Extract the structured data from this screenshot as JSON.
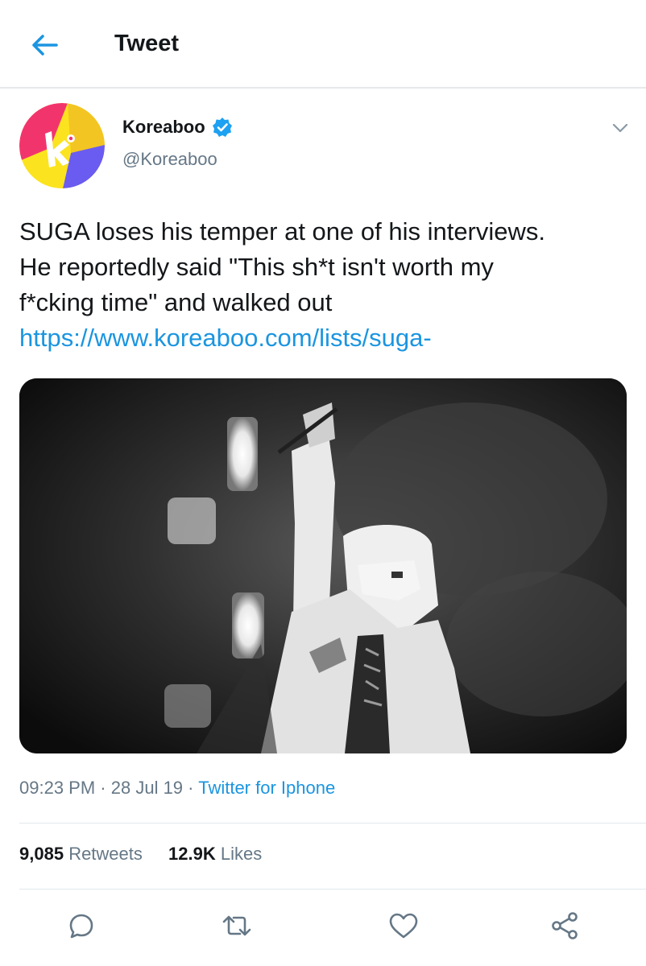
{
  "header": {
    "title": "Tweet"
  },
  "author": {
    "name": "Koreaboo",
    "handle": "@Koreaboo",
    "verified": true
  },
  "tweet": {
    "lines": [
      "SUGA loses his temper at one of his interviews.",
      "He reportedly said \"This sh*t isn't worth my",
      "f*cking time\" and walked out"
    ],
    "link": "https://www.koreaboo.com/lists/suga-"
  },
  "meta": {
    "time": "09:23 PM",
    "date": "28 Jul 19",
    "separator": "·",
    "source": "Twitter for Iphone"
  },
  "stats": {
    "retweets_count": "9,085",
    "retweets_label": "Retweets",
    "likes_count": "12.9K",
    "likes_label": "Likes"
  },
  "colors": {
    "accent": "#1b95e0",
    "text": "#14171a",
    "secondary": "#657786",
    "divider": "#e1e8ed"
  },
  "icons": {
    "back": "arrow-left-icon",
    "verified": "verified-badge-icon",
    "more": "chevron-down-icon",
    "reply": "reply-icon",
    "retweet": "retweet-icon",
    "like": "heart-icon",
    "share": "share-icon"
  }
}
